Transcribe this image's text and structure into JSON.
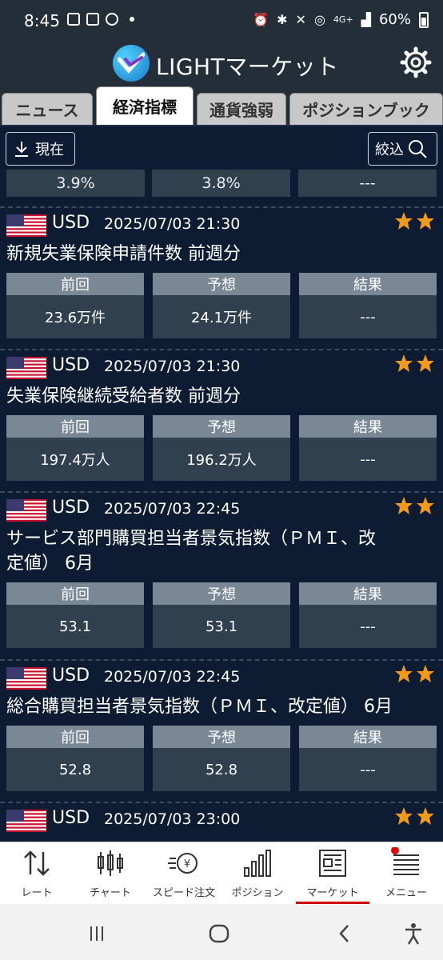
{
  "status_bar": {
    "time": "8:45",
    "battery": "60%",
    "network": "4G+"
  },
  "header": {
    "app_title": "LIGHTマーケット"
  },
  "tabs": [
    {
      "label": "ニュース",
      "active": false
    },
    {
      "label": "経済指標",
      "active": true
    },
    {
      "label": "通貨強弱",
      "active": false
    },
    {
      "label": "ポジションブック",
      "active": false
    }
  ],
  "toolbar": {
    "now_label": "現在",
    "filter_label": "絞込"
  },
  "partial_row": {
    "values": [
      "3.9%",
      "3.8%",
      "---"
    ]
  },
  "column_labels": {
    "previous": "前回",
    "forecast": "予想",
    "result": "結果"
  },
  "events": [
    {
      "currency": "USD",
      "datetime": "2025/07/03 21:30",
      "stars": 2,
      "title_lines": [
        "新規失業保険申請件数 前週分"
      ],
      "previous": "23.6万件",
      "forecast": "24.1万件",
      "result": "---"
    },
    {
      "currency": "USD",
      "datetime": "2025/07/03 21:30",
      "stars": 2,
      "title_lines": [
        "失業保険継続受給者数 前週分"
      ],
      "previous": "197.4万人",
      "forecast": "196.2万人",
      "result": "---"
    },
    {
      "currency": "USD",
      "datetime": "2025/07/03 22:45",
      "stars": 2,
      "title_lines": [
        "サービス部門購買担当者景気指数（ＰＭＩ、改",
        "定値） 6月"
      ],
      "previous": "53.1",
      "forecast": "53.1",
      "result": "---"
    },
    {
      "currency": "USD",
      "datetime": "2025/07/03 22:45",
      "stars": 2,
      "title_lines": [
        "総合購買担当者景気指数（ＰＭＩ、改定値） 6月"
      ],
      "previous": "52.8",
      "forecast": "52.8",
      "result": "---"
    },
    {
      "currency": "USD",
      "datetime": "2025/07/03 23:00",
      "stars": 2,
      "title_lines": [],
      "previous": "",
      "forecast": "",
      "result": ""
    }
  ],
  "bottom_nav": [
    {
      "label": "レート",
      "icon": "arrows-updown-icon"
    },
    {
      "label": "チャート",
      "icon": "candlestick-icon"
    },
    {
      "label": "スピード注文",
      "icon": "yen-speed-icon"
    },
    {
      "label": "ポジション",
      "icon": "bars-icon"
    },
    {
      "label": "マーケット",
      "icon": "newspaper-icon",
      "active": true
    },
    {
      "label": "メニュー",
      "icon": "menu-lines-icon",
      "badge": true
    }
  ],
  "colors": {
    "background": "#0d1b33",
    "accent_star": "#f29a1a",
    "active_underline": "#d40000"
  }
}
